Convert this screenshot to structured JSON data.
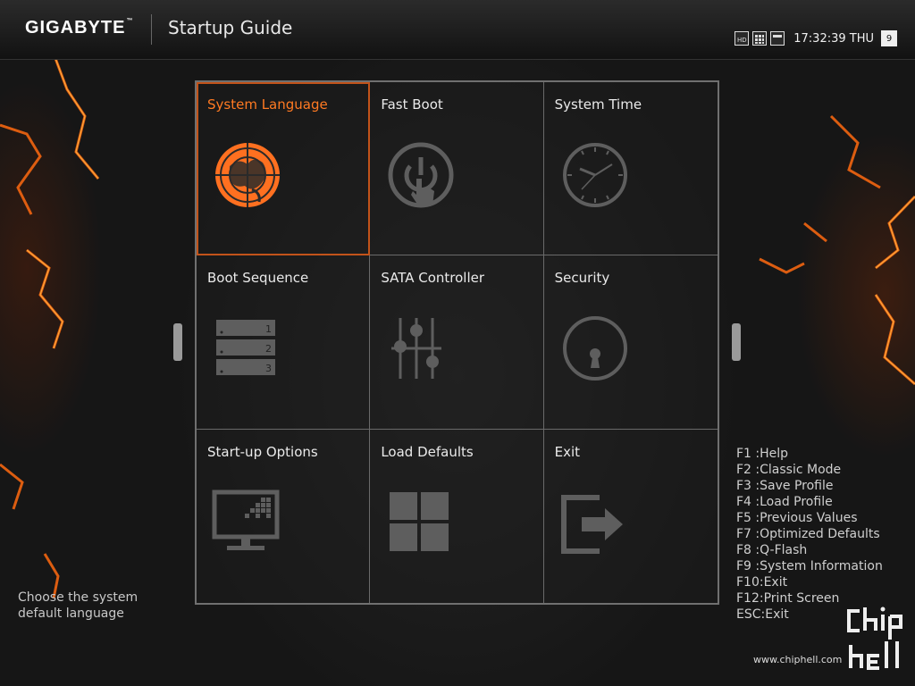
{
  "header": {
    "brand": "GIGABYTE",
    "brand_tm": "™",
    "title": "Startup Guide",
    "time": "17:32:39 THU",
    "calendar_day": "9",
    "status_icons": [
      "hd-icon",
      "grid-view-icon",
      "window-icon"
    ]
  },
  "colors": {
    "accent": "#ff7a22",
    "tile_border": "#6a6a6a",
    "icon_gray": "#5e5e5e"
  },
  "tiles": [
    {
      "label": "System Language",
      "icon": "globe-icon",
      "selected": true
    },
    {
      "label": "Fast Boot",
      "icon": "power-touch-icon"
    },
    {
      "label": "System Time",
      "icon": "clock-icon"
    },
    {
      "label": "Boot Sequence",
      "icon": "boot-list-icon"
    },
    {
      "label": "SATA Controller",
      "icon": "sliders-icon"
    },
    {
      "label": "Security",
      "icon": "lock-icon"
    },
    {
      "label": "Start-up Options",
      "icon": "monitor-icon"
    },
    {
      "label": "Load Defaults",
      "icon": "windows-grid-icon"
    },
    {
      "label": "Exit",
      "icon": "exit-icon"
    }
  ],
  "boot_list_numbers": [
    "1",
    "2",
    "3"
  ],
  "help_text": [
    "Choose the system",
    "default language"
  ],
  "hotkeys": [
    "F1 :Help",
    "F2 :Classic Mode",
    "F3 :Save Profile",
    "F4 :Load Profile",
    "F5 :Previous Values",
    "F7 :Optimized Defaults",
    "F8 :Q-Flash",
    "F9 :System Information",
    "F10:Exit",
    "F12:Print Screen",
    "ESC:Exit"
  ],
  "watermark": "www.chiphell.com"
}
